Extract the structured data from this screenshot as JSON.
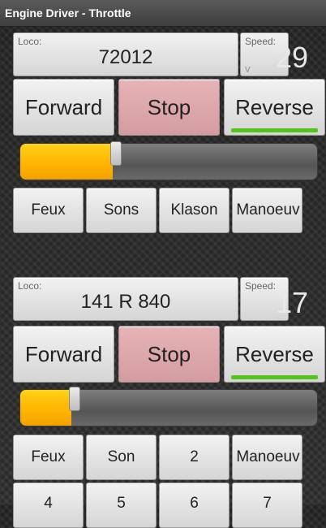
{
  "title": "Engine Driver - Throttle",
  "throttles": [
    {
      "loco_label": "Loco:",
      "loco_name": "72012",
      "speed_label": "Speed:",
      "speed_value": "29",
      "speed_unit": "V",
      "forward_label": "Forward",
      "stop_label": "Stop",
      "reverse_label": "Reverse",
      "active_direction": "reverse",
      "speed_fraction": 0.31,
      "functions": [
        "Feux",
        "Sons",
        "Klason",
        "Manoeuv"
      ]
    },
    {
      "loco_label": "Loco:",
      "loco_name": "141 R 840",
      "speed_label": "Speed:",
      "speed_value": "17",
      "forward_label": "Forward",
      "stop_label": "Stop",
      "reverse_label": "Reverse",
      "active_direction": "reverse",
      "speed_fraction": 0.17,
      "functions": [
        "Feux",
        "Son",
        "2",
        "Manoeuv"
      ],
      "functions_row2": [
        "4",
        "5",
        "6",
        "7"
      ]
    }
  ],
  "colors": {
    "slider_fill": "#ffb400",
    "active_direction": "#55c41a",
    "stop_button": "#e0a9ad"
  }
}
